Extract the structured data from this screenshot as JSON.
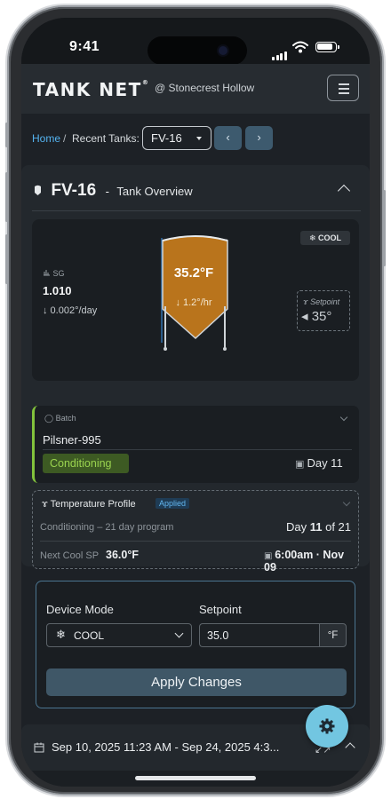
{
  "status_bar": {
    "time": "9:41"
  },
  "header": {
    "logo": "TANK NET",
    "logo_mark": "®",
    "site": "@ Stonecrest Hollow"
  },
  "breadcrumb": {
    "home": "Home",
    "separator": "/",
    "recent_label": "Recent Tanks:",
    "selected_tank": "FV-16",
    "prev": "‹",
    "next": "›"
  },
  "panel": {
    "tank_name": "FV-16",
    "dash": "-",
    "subtitle": "Tank Overview",
    "mode_badge": "COOL",
    "sg": {
      "label": "SG",
      "value": "1.010",
      "rate": "↓ 0.002°/day"
    },
    "tank": {
      "temp": "35.2°F",
      "rate": "↓ 1.2°/hr",
      "fill_color": "#b9741c"
    },
    "setpoint": {
      "label": "Setpoint",
      "value": "◂ 35°"
    }
  },
  "batch": {
    "label": "Batch",
    "name": "Pilsner-995",
    "stage": "Conditioning",
    "day": "Day 11",
    "accent": "#82c23c"
  },
  "profile": {
    "title": "Temperature  Profile",
    "badge": "Applied",
    "program": "Conditioning – 21 day program",
    "day_prefix": "Day ",
    "day_current": "11",
    "day_suffix": " of 21",
    "next_label": "Next Cool SP",
    "next_value": "36.0°F",
    "next_time": "6:00am · Nov 09"
  },
  "controls": {
    "mode_label": "Device Mode",
    "mode_value": "COOL",
    "setpoint_label": "Setpoint",
    "setpoint_value": "35.0",
    "unit": "°F",
    "apply": "Apply Changes"
  },
  "footer": {
    "date_range": "Sep 10, 2025 11:23 AM  -  Sep 24, 2025  4:3...",
    "expand": "↙↗"
  },
  "colors": {
    "accent_blue": "#54b3f0",
    "fab": "#72c6e1",
    "stage_green": "#9ad34f"
  }
}
